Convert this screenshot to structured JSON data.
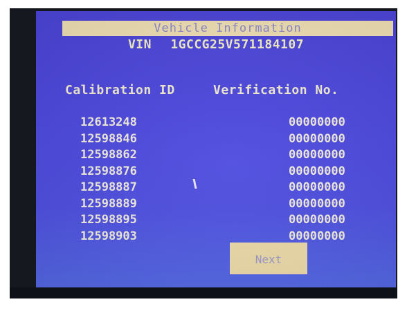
{
  "screen": {
    "title": "Vehicle Information",
    "vin_label": "VIN",
    "vin_value": "1GCCG25V571184107"
  },
  "table": {
    "col_calibration_header": "Calibration ID",
    "col_verification_header": "Verification No.",
    "rows": [
      {
        "calibration_id": "12613248",
        "verification_no": "00000000"
      },
      {
        "calibration_id": "12598846",
        "verification_no": "00000000"
      },
      {
        "calibration_id": "12598862",
        "verification_no": "00000000"
      },
      {
        "calibration_id": "12598876",
        "verification_no": "00000000"
      },
      {
        "calibration_id": "12598887",
        "verification_no": "00000000"
      },
      {
        "calibration_id": "12598889",
        "verification_no": "00000000"
      },
      {
        "calibration_id": "12598895",
        "verification_no": "00000000"
      },
      {
        "calibration_id": "12598903",
        "verification_no": "00000000"
      }
    ]
  },
  "buttons": {
    "next_label": "Next"
  },
  "colors": {
    "screen_background": "#4c48de",
    "title_bar": "#f0dfb4",
    "button_background": "#ead8a6",
    "text": "#efeadc"
  }
}
